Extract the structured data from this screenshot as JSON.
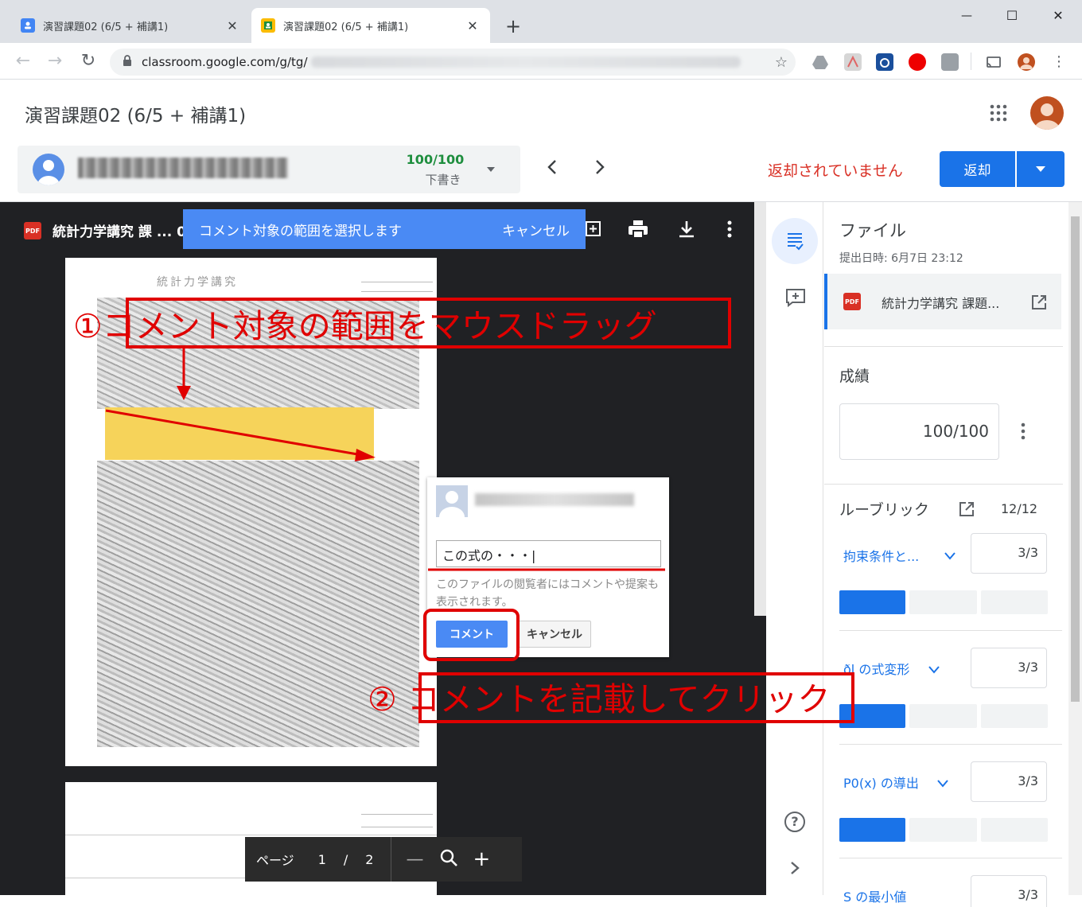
{
  "browser": {
    "tabs": [
      {
        "title": "演習課題02 (6/5 + 補講1)",
        "active": false
      },
      {
        "title": "演習課題02 (6/5 + 補講1)",
        "active": true
      }
    ],
    "new_tab": "+",
    "window_controls": {
      "minimize": "—",
      "maximize": "☐",
      "close": "✕"
    },
    "url": "classroom.google.com/g/tg/"
  },
  "header": {
    "title": "演習課題02 (6/5 + 補講1)",
    "student": {
      "score": "100/100",
      "status": "下書き"
    },
    "not_returned": "返却されていません",
    "return_button": "返却"
  },
  "viewer": {
    "file_title": "統計力学講究 課 ... 0:",
    "selection_banner": {
      "text": "コメント対象の範囲を選択します",
      "cancel": "キャンセル"
    },
    "comment_popup": {
      "input_value": "この式の・・・|",
      "notice": "このファイルの閲覧者にはコメントや提案も表示されます。",
      "comment_button": "コメント",
      "cancel_button": "キャンセル"
    },
    "page_nav": {
      "label": "ページ",
      "current": "1",
      "separator": "/",
      "total": "2"
    },
    "handwriting": {
      "title": "統計力学講究"
    }
  },
  "annotations": {
    "step1": "①コメント対象の範囲をマウスドラッグ",
    "step2": "② コメントを記載してクリック"
  },
  "side_panel": {
    "files_heading": "ファイル",
    "submitted": "提出日時: 6月7日 23:12",
    "file_name": "統計力学講究 課題...",
    "grade_heading": "成績",
    "grade_value": "100/100",
    "rubric_heading": "ルーブリック",
    "rubric_total": "12/12",
    "criteria": [
      {
        "name": "拘束条件と...",
        "score": "3/3",
        "filled": 1
      },
      {
        "name": "ðl の式変形",
        "score": "3/3",
        "filled": 1
      },
      {
        "name": "P0(x) の導出",
        "score": "3/3",
        "filled": 1
      },
      {
        "name": "S の最小値",
        "score": "3/3"
      }
    ]
  },
  "colors": {
    "accent": "#1a73e8",
    "red": "#e00000",
    "highlight": "#f6d35a",
    "viewer_bg": "#202124"
  }
}
